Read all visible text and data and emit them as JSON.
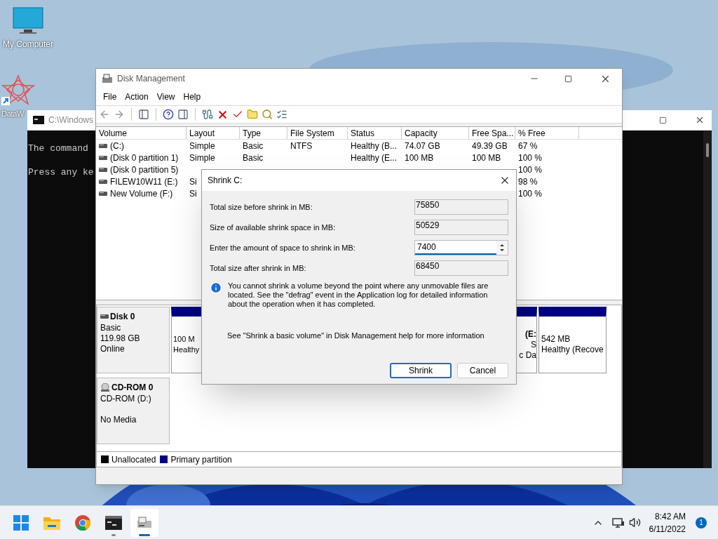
{
  "desktop": {
    "icons": [
      {
        "kind": "computer",
        "label": "My Computer"
      },
      {
        "kind": "shortcut",
        "label": "DataW"
      }
    ]
  },
  "console": {
    "title": "C:\\Windows",
    "lines": [
      "The command",
      "Press any ke"
    ]
  },
  "disk_management": {
    "title": "Disk Management",
    "menu": [
      "File",
      "Action",
      "View",
      "Help"
    ],
    "toolbar": [
      {
        "kind": "back",
        "disabled": true
      },
      {
        "kind": "forward",
        "disabled": true
      },
      {
        "kind": "sep"
      },
      {
        "kind": "panel"
      },
      {
        "kind": "sep"
      },
      {
        "kind": "help"
      },
      {
        "kind": "panel2"
      },
      {
        "kind": "sep"
      },
      {
        "kind": "connect"
      },
      {
        "kind": "delete"
      },
      {
        "kind": "check"
      },
      {
        "kind": "folder-up"
      },
      {
        "kind": "folder-search"
      },
      {
        "kind": "properties"
      }
    ],
    "columns": [
      "Volume",
      "Layout",
      "Type",
      "File System",
      "Status",
      "Capacity",
      "Free Spa...",
      "% Free"
    ],
    "rows": [
      {
        "cells": [
          "(C:)",
          "Simple",
          "Basic",
          "NTFS",
          "Healthy (B...",
          "74.07 GB",
          "49.39 GB",
          "67 %"
        ]
      },
      {
        "cells": [
          "(Disk 0 partition 1)",
          "Simple",
          "Basic",
          null,
          "Healthy (E...",
          "100 MB",
          "100 MB",
          "100 %"
        ]
      },
      {
        "cells": [
          "(Disk 0 partition 5)",
          null,
          null,
          null,
          null,
          null,
          null,
          "100 %"
        ]
      },
      {
        "cells": [
          "FILEW10W11 (E:)",
          "Si",
          null,
          null,
          null,
          null,
          null,
          "98 %"
        ]
      },
      {
        "cells": [
          "New Volume (F:)",
          "Si",
          null,
          null,
          null,
          null,
          null,
          "100 %"
        ]
      }
    ],
    "disks": [
      {
        "kind": "disk",
        "name": "Disk 0",
        "lines": [
          "Basic",
          "119.98 GB",
          "Online"
        ],
        "partitions": [
          {
            "lines": [
              "100 M",
              "Healthy"
            ]
          },
          {
            "lines": [
              "(E:",
              "S",
              "c Da"
            ]
          },
          {
            "lines": [
              "542 MB",
              "Healthy (Recove"
            ]
          }
        ]
      },
      {
        "kind": "cdrom",
        "name": "CD-ROM 0",
        "lines": [
          "CD-ROM (D:)",
          "No Media"
        ]
      }
    ],
    "legend": [
      {
        "label": "Unallocated",
        "color": "#000000"
      },
      {
        "label": "Primary partition",
        "color": "#000080"
      }
    ]
  },
  "dialog": {
    "title": "Shrink C:",
    "fields": [
      {
        "label": "Total size before shrink in MB:",
        "value": "75850",
        "kind": "readonly"
      },
      {
        "label": "Size of available shrink space in MB:",
        "value": "50529",
        "kind": "readonly"
      },
      {
        "label": "Enter the amount of space to shrink in MB:",
        "value": "7400",
        "kind": "spin"
      },
      {
        "label": "Total size after shrink in MB:",
        "value": "68450",
        "kind": "readonly"
      }
    ],
    "info": "You cannot shrink a volume beyond the point where any unmovable files are located. See the \"defrag\" event in the Application log for detailed information about the operation when it has completed.",
    "help": "See \"Shrink a basic volume\" in Disk Management help for more information",
    "buttons": [
      {
        "label": "Shrink",
        "default": true
      },
      {
        "label": "Cancel",
        "default": false
      }
    ]
  },
  "taskbar": {
    "apps": [
      {
        "kind": "start",
        "running": false,
        "selected": false
      },
      {
        "kind": "explorer",
        "running": false,
        "selected": false
      },
      {
        "kind": "browser",
        "running": false,
        "selected": false
      },
      {
        "kind": "terminal",
        "running": true,
        "selected": false
      },
      {
        "kind": "disk",
        "running": true,
        "selected": true
      }
    ],
    "time": "8:42 AM",
    "date": "6/11/2022",
    "notifications": "1"
  }
}
